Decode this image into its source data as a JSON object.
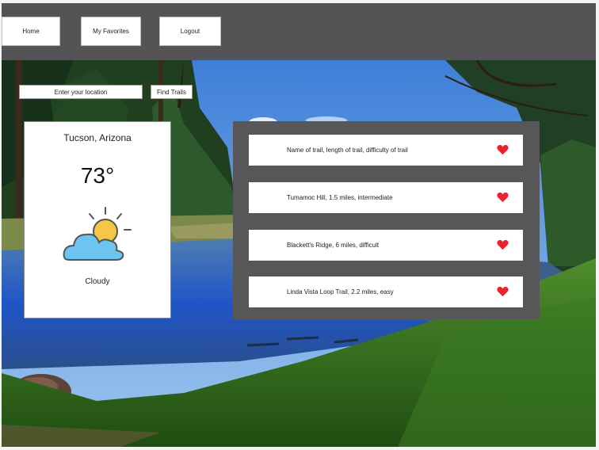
{
  "nav": {
    "home": "Home",
    "favorites": "My Favorites",
    "logout": "Logout"
  },
  "search": {
    "placeholder": "Enter your location",
    "button": "Find Trails"
  },
  "weather": {
    "city": "Tucson, Arizona",
    "temperature": "73°",
    "condition": "Cloudy",
    "icon": "partly-cloudy-icon"
  },
  "trails": [
    {
      "text": "Name of trail, length of trail, difficulty of trail",
      "favorite_icon": "heart-icon"
    },
    {
      "text": "Tumamoc Hill, 1.5 miles, intermediate",
      "favorite_icon": "heart-icon"
    },
    {
      "text": "Blackett's Ridge, 6 miles, difficult",
      "favorite_icon": "heart-icon"
    },
    {
      "text": "Linda Vista Loop Trail, 2.2 miles, easy",
      "favorite_icon": "heart-icon"
    }
  ],
  "colors": {
    "topbar": "#545356",
    "panel": "#575659",
    "heart": "#e8242c",
    "sun": "#f6c646",
    "cloud": "#6cc4f0"
  }
}
